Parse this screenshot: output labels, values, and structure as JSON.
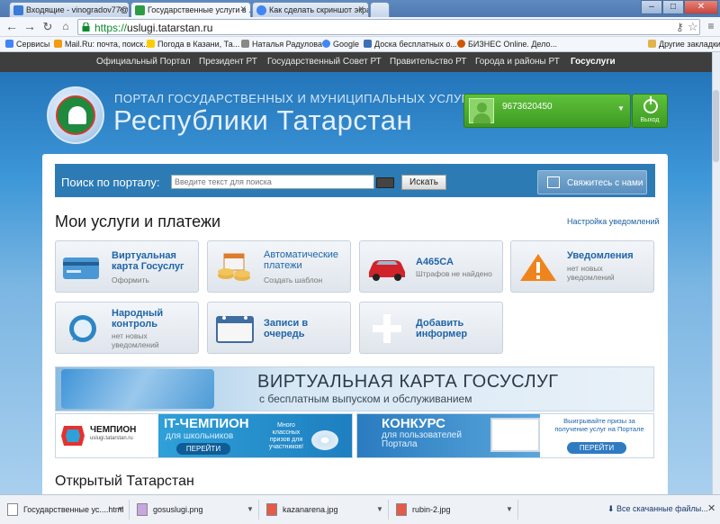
{
  "browser": {
    "tabs": [
      {
        "label": "Входящие - vinogradov77@...",
        "favicon_color": "#3a7bd5"
      },
      {
        "label": "Государственные услуги в ...",
        "favicon_color": "#2e9b45"
      },
      {
        "label": "Как сделать скриншот экра...",
        "favicon_color": "#4285f4"
      }
    ],
    "url_scheme": "https://",
    "url_host": "uslugi.tatarstan.ru",
    "bookmarks": [
      {
        "label": "Сервисы",
        "color": "#4285f4"
      },
      {
        "label": "Mail.Ru: почта, поиск...",
        "color": "#f39c12"
      },
      {
        "label": "Погода в Казани, Та...",
        "color": "#ffcc00"
      },
      {
        "label": "Наталья Радулова",
        "color": "#888888"
      },
      {
        "label": "Google",
        "color": "#4285f4"
      },
      {
        "label": "Доска бесплатных о...",
        "color": "#3b6fb6"
      },
      {
        "label": "БИЗНЕС Online. Дело...",
        "color": "#d35400"
      },
      {
        "label": "Другие закладки",
        "color": "#e0b34c"
      }
    ]
  },
  "topnav": [
    "Официальный Портал",
    "Президент РТ",
    "Государственный Совет РТ",
    "Правительство РТ",
    "Города и районы РТ",
    "Госуслуги"
  ],
  "header": {
    "subtitle": "ПОРТАЛ ГОСУДАРСТВЕННЫХ И МУНИЦИПАЛЬНЫХ УСЛУГ",
    "title": "Республики Татарстан",
    "user_phone": "9673620450",
    "logout_label": "Выход"
  },
  "search": {
    "label": "Поиск по порталу:",
    "placeholder": "Введите текст для поиска",
    "button": "Искать",
    "contact_button": "Свяжитесь с нами"
  },
  "services": {
    "title": "Мои услуги и платежи",
    "settings_link": "Настройка уведомлений",
    "cards": [
      {
        "title": "Виртуальная карта Госуслуг",
        "sub": "Оформить"
      },
      {
        "title": "Автоматические платежи",
        "sub": "Создать шаблон"
      },
      {
        "title": "А465СА",
        "sub": "Штрафов не найдено"
      },
      {
        "title": "Уведомления",
        "sub": "нет новых уведомлений"
      },
      {
        "title": "Народный контроль",
        "sub": "нет новых уведомлений"
      },
      {
        "title": "Записи в очередь",
        "sub": ""
      },
      {
        "title": "Добавить информер",
        "sub": ""
      }
    ]
  },
  "banner": {
    "title": "ВИРТУАЛЬНАЯ КАРТА ГОСУСЛУГ",
    "subtitle": "с бесплатным выпуском и обслуживанием"
  },
  "promo_it": {
    "brand": "ЧЕМПИОН",
    "brand_url": "uslugi.tatarstan.ru",
    "title": "IT-ЧЕМПИОН",
    "subtitle": "для школьников",
    "prize": "Много классных призов для участников!",
    "button": "ПЕРЕЙТИ"
  },
  "promo_contest": {
    "title": "КОНКУРС",
    "subtitle": "для пользователей Портала",
    "text": "Выигрывайте призы за получение услуг на Портале",
    "button": "ПЕРЕЙТИ"
  },
  "open_title": "Открытый Татарстан",
  "downloads": {
    "items": [
      "Государственные ус....html",
      "gosuslugi.png",
      "kazanarena.jpg",
      "rubin-2.jpg"
    ],
    "all_label": "Все скачанные файлы..."
  }
}
